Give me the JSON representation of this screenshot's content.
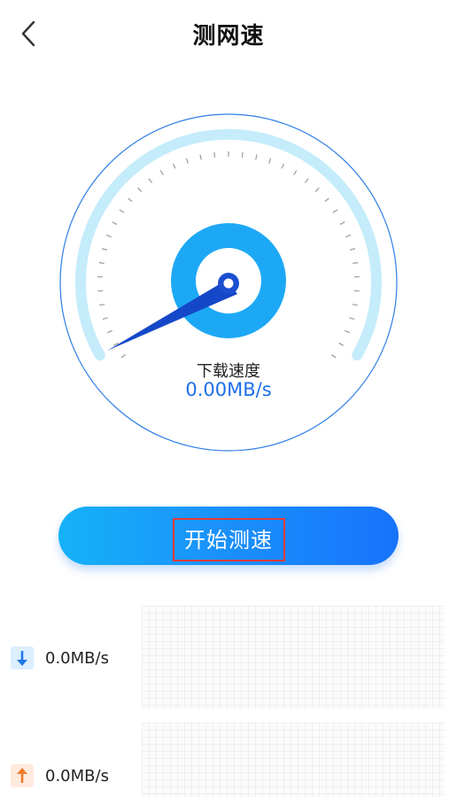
{
  "header": {
    "title": "测网速",
    "back_icon": "chevron-left-icon"
  },
  "gauge": {
    "label": "下载速度",
    "value": "0.00MB/s",
    "current_speed": 0.0,
    "colors": {
      "outer_ring": "#2f7fe6",
      "arc": "#c5ecfb",
      "ticks": "#9a9a9a",
      "hub_outer": "#1da8f6",
      "needle": "#1548c8"
    }
  },
  "start_button": {
    "label": "开始测速",
    "gradient": [
      "#15b2f7",
      "#1773fb"
    ],
    "highlight_color": "#e63a3a"
  },
  "stats": {
    "download": {
      "value": "0.0MB/s",
      "icon": "arrow-down-icon",
      "color": "#1e78e6"
    },
    "upload": {
      "value": "0.0MB/s",
      "icon": "arrow-up-icon",
      "color": "#f07b28"
    }
  }
}
